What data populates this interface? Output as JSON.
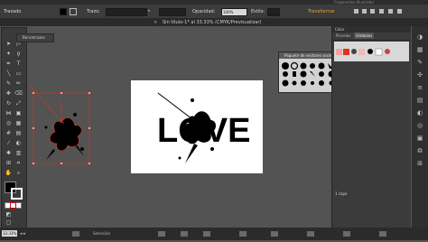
{
  "menubar": {
    "title": "Fragmentos Illustrator"
  },
  "control_bar": {
    "selection_label": "Trazado",
    "stroke_label": "Trazo:",
    "opacity_label": "Opacidad:",
    "opacity_value": "100%",
    "style_label": "Estilo:",
    "transform_label": "Transformar"
  },
  "document": {
    "title": "Sin título-1* al 33.33% (CMYK/Previsualizar)"
  },
  "symbol_panel": {
    "label": "Bencetrazos"
  },
  "library_panel": {
    "title": "Paquete de vectores sociedad"
  },
  "dock": {
    "header": "Color",
    "tabs": [
      "Pinceles",
      "Símbolos"
    ],
    "footer_label": "1 capa"
  },
  "artwork": {
    "word": "LOVE"
  },
  "statusbar": {
    "zoom": "33.33%",
    "tool": "Selección"
  },
  "colors": {
    "accent_red": "#e0311f",
    "panel_bg": "#3b3b3b"
  }
}
